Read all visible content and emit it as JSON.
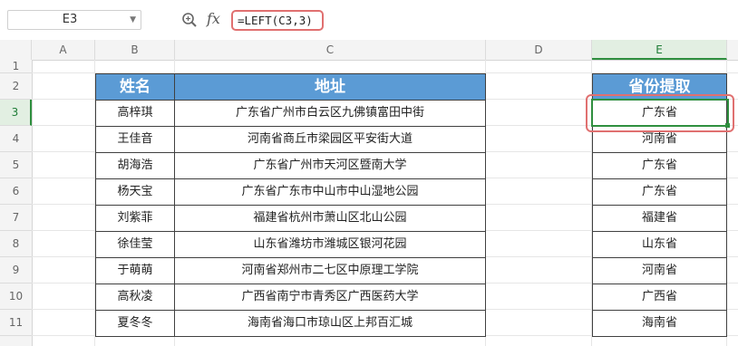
{
  "name_box": {
    "value": "E3"
  },
  "formula_bar": {
    "fx_label": "fx",
    "formula": "=LEFT(C3,3)"
  },
  "columns": [
    "A",
    "B",
    "C",
    "D",
    "E"
  ],
  "rows": [
    "1",
    "2",
    "3",
    "4",
    "5",
    "6",
    "7",
    "8",
    "9",
    "10",
    "11"
  ],
  "selected_cell": "E3",
  "table": {
    "headers": {
      "name": "姓名",
      "address": "地址",
      "province": "省份提取"
    },
    "records": [
      {
        "name": "高梓琪",
        "address": "广东省广州市白云区九佛镇富田中街",
        "province": "广东省"
      },
      {
        "name": "王佳音",
        "address": "河南省商丘市梁园区平安街大道",
        "province": "河南省"
      },
      {
        "name": "胡海浩",
        "address": "广东省广州市天河区暨南大学",
        "province": "广东省"
      },
      {
        "name": "杨天宝",
        "address": "广东省广东市中山市中山湿地公园",
        "province": "广东省"
      },
      {
        "name": "刘紫菲",
        "address": "福建省杭州市萧山区北山公园",
        "province": "福建省"
      },
      {
        "name": "徐佳莹",
        "address": "山东省潍坊市潍城区银河花园",
        "province": "山东省"
      },
      {
        "name": "于萌萌",
        "address": "河南省郑州市二七区中原理工学院",
        "province": "河南省"
      },
      {
        "name": "高秋凌",
        "address": "广西省南宁市青秀区广西医药大学",
        "province": "广西省"
      },
      {
        "name": "夏冬冬",
        "address": "海南省海口市琼山区上邦百汇城",
        "province": "海南省"
      }
    ]
  },
  "colors": {
    "header_fill": "#5b9bd5",
    "highlight": "#e07070",
    "selection": "#2f8f3f"
  }
}
